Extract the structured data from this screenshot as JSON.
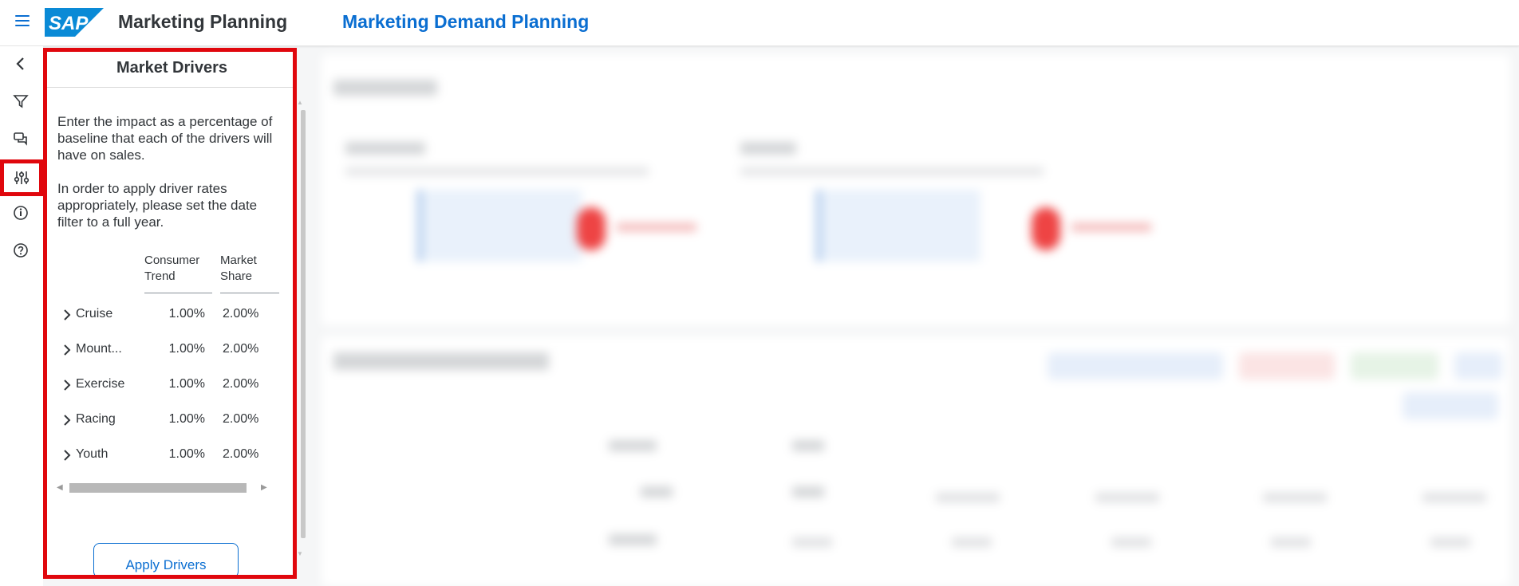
{
  "header": {
    "menu_icon": "hamburger-menu-icon",
    "logo": "SAP",
    "app_title": "Marketing Planning",
    "page_title": "Marketing Demand Planning"
  },
  "rail": {
    "items": [
      {
        "icon": "chevron-left-icon"
      },
      {
        "icon": "filter-icon"
      },
      {
        "icon": "comments-icon"
      },
      {
        "icon": "sliders-icon",
        "active": true
      },
      {
        "icon": "info-icon"
      },
      {
        "icon": "help-icon"
      }
    ]
  },
  "panel": {
    "title": "Market Drivers",
    "desc1": "Enter the impact as a percentage of baseline that each of the drivers will have on sales.",
    "desc2": "In order to apply driver rates appropriately, please set the date filter to a full year.",
    "col1_line1": "Consumer",
    "col1_line2": "Trend",
    "col2_line1": "Market",
    "col2_line2": "Share",
    "rows": [
      {
        "name": "Cruise",
        "v1": "1.00%",
        "v2": "2.00%"
      },
      {
        "name": "Mount...",
        "v1": "1.00%",
        "v2": "2.00%"
      },
      {
        "name": "Exercise",
        "v1": "1.00%",
        "v2": "2.00%"
      },
      {
        "name": "Racing",
        "v1": "1.00%",
        "v2": "2.00%"
      },
      {
        "name": "Youth",
        "v1": "1.00%",
        "v2": "2.00%"
      }
    ],
    "apply_label": "Apply Drivers"
  },
  "colors": {
    "accent": "#0a6ed1",
    "highlight": "#e0070d"
  }
}
